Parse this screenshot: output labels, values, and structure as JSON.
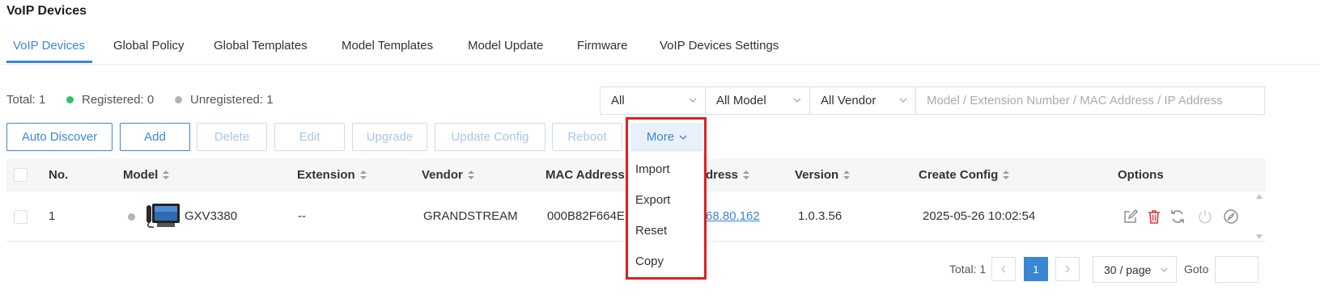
{
  "page": {
    "title": "VoIP Devices"
  },
  "tabs": [
    {
      "label": "VoIP Devices",
      "active": true
    },
    {
      "label": "Global Policy"
    },
    {
      "label": "Global Templates"
    },
    {
      "label": "Model Templates"
    },
    {
      "label": "Model Update"
    },
    {
      "label": "Firmware"
    },
    {
      "label": "VoIP Devices Settings"
    }
  ],
  "summary": {
    "total": "Total: 1",
    "registered": "Registered: 0",
    "unregistered": "Unregistered: 1"
  },
  "filters": {
    "status": "All",
    "model": "All Model",
    "vendor": "All Vendor",
    "search_placeholder": "Model / Extension Number / MAC Address / IP Address"
  },
  "toolbar": {
    "auto_discover": "Auto Discover",
    "add": "Add",
    "delete": "Delete",
    "edit": "Edit",
    "upgrade": "Upgrade",
    "update_config": "Update Config",
    "reboot": "Reboot",
    "more": "More"
  },
  "more_menu": [
    "Import",
    "Export",
    "Reset",
    "Copy"
  ],
  "table": {
    "headers": {
      "no": "No.",
      "model": "Model",
      "extension": "Extension",
      "vendor": "Vendor",
      "mac": "MAC Address",
      "ip": "dress",
      "version": "Version",
      "create_config": "Create Config",
      "options": "Options"
    },
    "rows": [
      {
        "no": "1",
        "model": "GXV3380",
        "extension": "--",
        "vendor": "GRANDSTREAM",
        "mac": "000B82F664E",
        "ip": "68.80.162",
        "version": "1.0.3.56",
        "create_config": "2025-05-26 10:02:54"
      }
    ]
  },
  "pagination": {
    "total": "Total: 1",
    "current_page": "1",
    "page_size": "30 / page",
    "goto_label": "Goto"
  },
  "colors": {
    "accent": "#3a86d4",
    "registered": "#2fbf71",
    "unregistered": "#b0b3b8",
    "delete_icon": "#e0383e",
    "highlight": "#e02020"
  }
}
